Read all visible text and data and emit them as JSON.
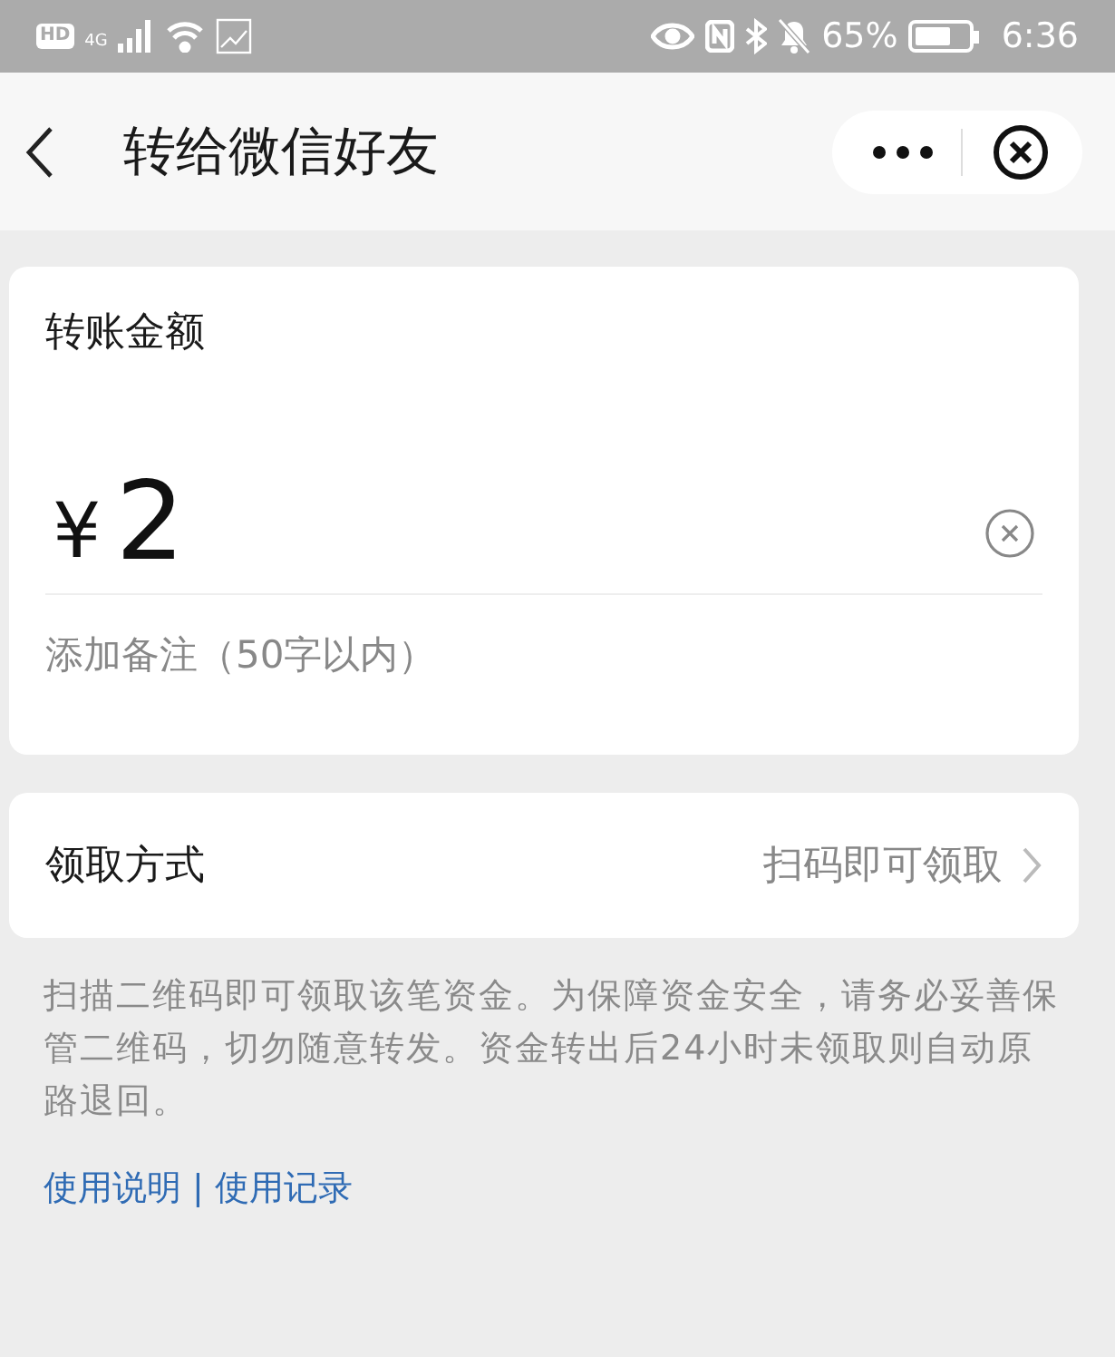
{
  "status_bar": {
    "left": [
      "HD",
      "4G"
    ],
    "battery": "65%",
    "time": "6:36"
  },
  "header": {
    "title": "转给微信好友"
  },
  "amount_card": {
    "label": "转账金额",
    "currency": "¥",
    "value": "2",
    "remark_placeholder": "添加备注（50字以内）"
  },
  "method": {
    "label": "领取方式",
    "value": "扫码即可领取"
  },
  "note": "扫描二维码即可领取该笔资金。为保障资金安全，请务必妥善保管二维码，切勿随意转发。资金转出后24小时未领取则自动原路退回。",
  "links": [
    {
      "label": "使用说明"
    },
    {
      "label": "使用记录"
    }
  ],
  "link_separator": "|"
}
